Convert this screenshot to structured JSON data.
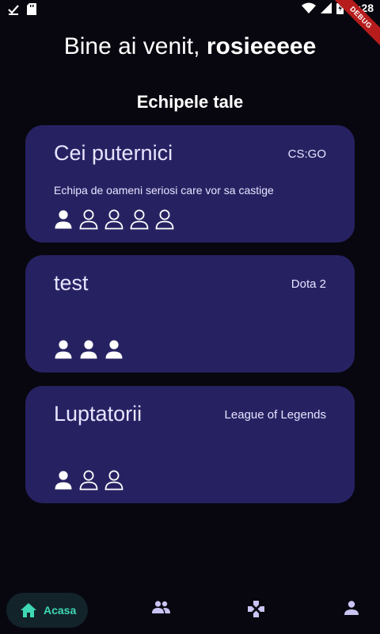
{
  "status_bar": {
    "time": "9:28",
    "debug_label": "DEBUG"
  },
  "greeting": {
    "prefix": "Bine ai venit,",
    "username": "rosieeeee"
  },
  "section_title": "Echipele tale",
  "teams": [
    {
      "name": "Cei puternici",
      "game": "CS:GO",
      "description": "Echipa de oameni seriosi care vor sa castige",
      "members": [
        "filled",
        "outline",
        "outline",
        "outline",
        "outline"
      ]
    },
    {
      "name": "test",
      "game": "Dota 2",
      "description": "",
      "members": [
        "filled",
        "filled",
        "filled"
      ]
    },
    {
      "name": "Luptatorii",
      "game": "League of Legends",
      "description": "",
      "members": [
        "filled",
        "outline",
        "outline"
      ]
    }
  ],
  "nav": {
    "home_label": "Acasa",
    "items": [
      "home-icon",
      "people-icon",
      "gamepad-icon",
      "person-icon"
    ]
  },
  "colors": {
    "background": "#08070f",
    "card": "#262262",
    "accent": "#3fd8b6",
    "nav_icon": "#c9c4f2"
  }
}
